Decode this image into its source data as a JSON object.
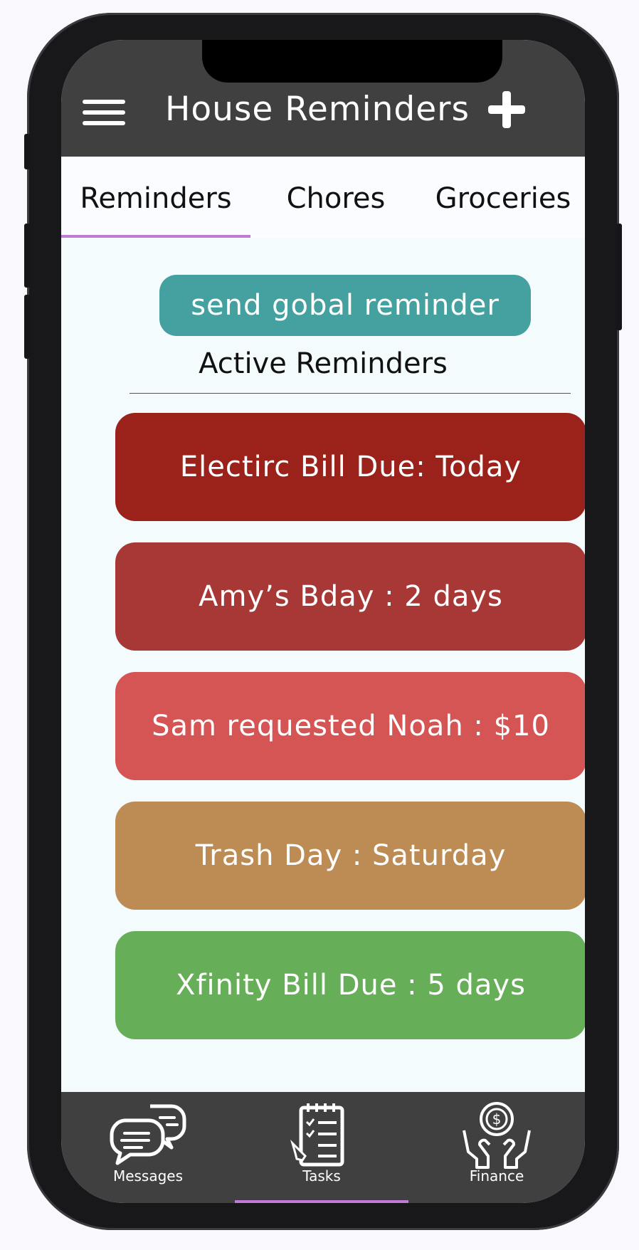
{
  "header": {
    "title": "House Reminders"
  },
  "tabs": [
    {
      "label": "Reminders",
      "active": true
    },
    {
      "label": "Chores",
      "active": false
    },
    {
      "label": "Groceries",
      "active": false
    }
  ],
  "global_button": {
    "label": "send gobal reminder",
    "color": "#45a19f"
  },
  "section": {
    "title": "Active Reminders"
  },
  "reminders": [
    {
      "label": "Electirc Bill Due: Today",
      "color": "#9b211b"
    },
    {
      "label": "Amy’s Bday : 2 days",
      "color": "#a73835"
    },
    {
      "label": "Sam requested Noah : $10",
      "color": "#d45553"
    },
    {
      "label": "Trash Day : Saturday",
      "color": "#bd8c55"
    },
    {
      "label": "Xfinity Bill Due : 5 days",
      "color": "#66ae58"
    }
  ],
  "bottom_nav": [
    {
      "label": "Messages",
      "icon": "messages-icon",
      "active": false
    },
    {
      "label": "Tasks",
      "icon": "tasks-icon",
      "active": true
    },
    {
      "label": "Finance",
      "icon": "finance-icon",
      "active": false
    }
  ],
  "colors": {
    "header": "#404040",
    "accent": "#c07ad4",
    "background": "#f3fbfd"
  }
}
